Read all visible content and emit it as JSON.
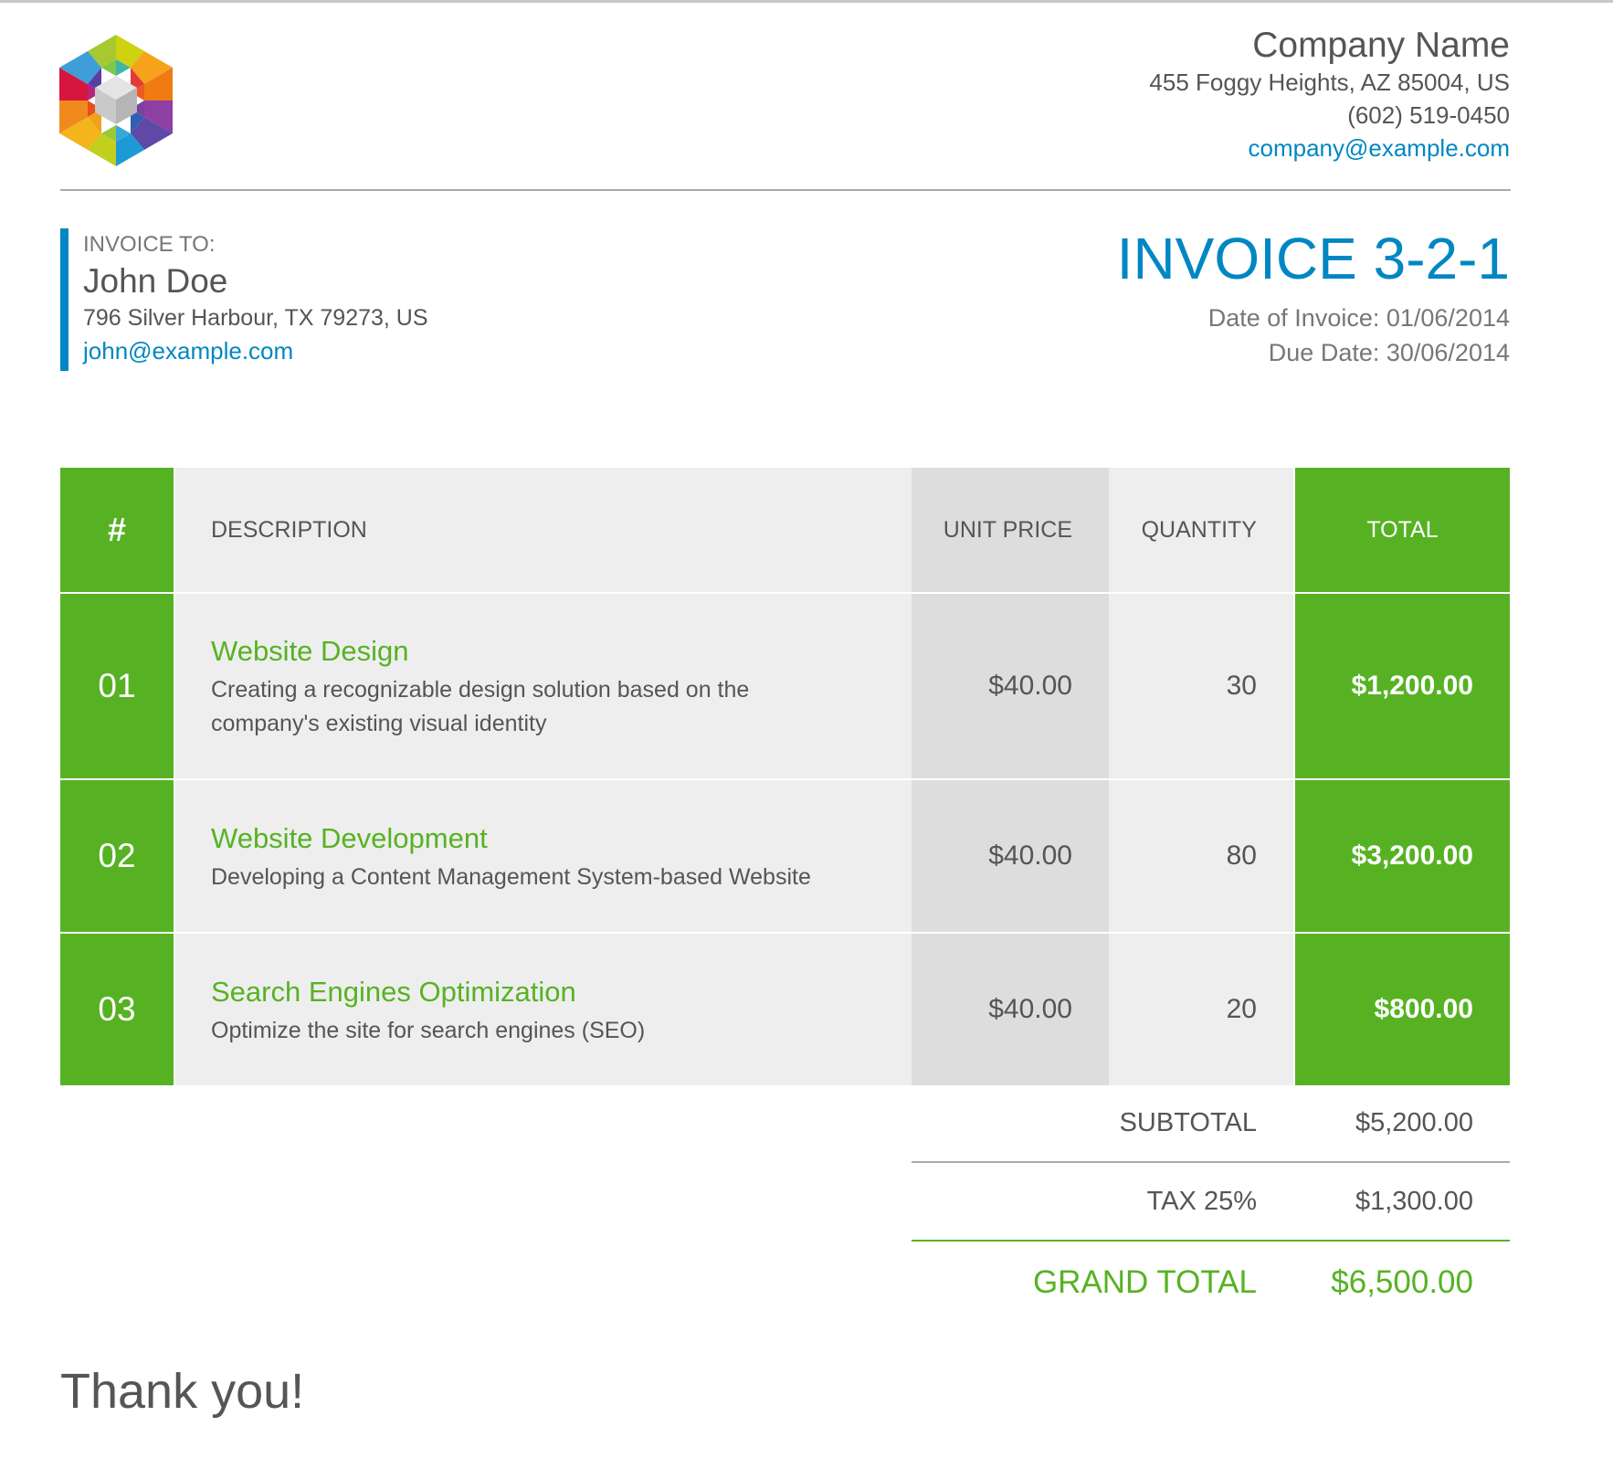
{
  "company": {
    "name": "Company Name",
    "address": "455 Foggy Heights, AZ 85004, US",
    "phone": "(602) 519-0450",
    "email": "company@example.com"
  },
  "client": {
    "label": "INVOICE TO:",
    "name": "John Doe",
    "address": "796 Silver Harbour, TX 79273, US",
    "email": "john@example.com"
  },
  "invoice": {
    "title": "INVOICE 3-2-1",
    "date": "Date of Invoice: 01/06/2014",
    "due": "Due Date: 30/06/2014"
  },
  "table": {
    "headers": {
      "no": "#",
      "description": "DESCRIPTION",
      "unit_price": "UNIT PRICE",
      "quantity": "QUANTITY",
      "total": "TOTAL"
    },
    "rows": [
      {
        "no": "01",
        "title": "Website Design",
        "description": "Creating a recognizable design solution based on the company's existing visual identity",
        "unit_price": "$40.00",
        "quantity": "30",
        "total": "$1,200.00"
      },
      {
        "no": "02",
        "title": "Website Development",
        "description": "Developing a Content Management System-based Website",
        "unit_price": "$40.00",
        "quantity": "80",
        "total": "$3,200.00"
      },
      {
        "no": "03",
        "title": "Search Engines Optimization",
        "description": "Optimize the site for search engines (SEO)",
        "unit_price": "$40.00",
        "quantity": "20",
        "total": "$800.00"
      }
    ]
  },
  "totals": {
    "subtotal_label": "SUBTOTAL",
    "subtotal": "$5,200.00",
    "tax_label": "TAX 25%",
    "tax": "$1,300.00",
    "grand_label": "GRAND TOTAL",
    "grand": "$6,500.00"
  },
  "footer": {
    "thanks": "Thank you!"
  },
  "colors": {
    "accent_green": "#57b223",
    "accent_blue": "#0087c3",
    "text": "#555555"
  },
  "icons": {
    "logo": "hexagon-cube-logo"
  }
}
